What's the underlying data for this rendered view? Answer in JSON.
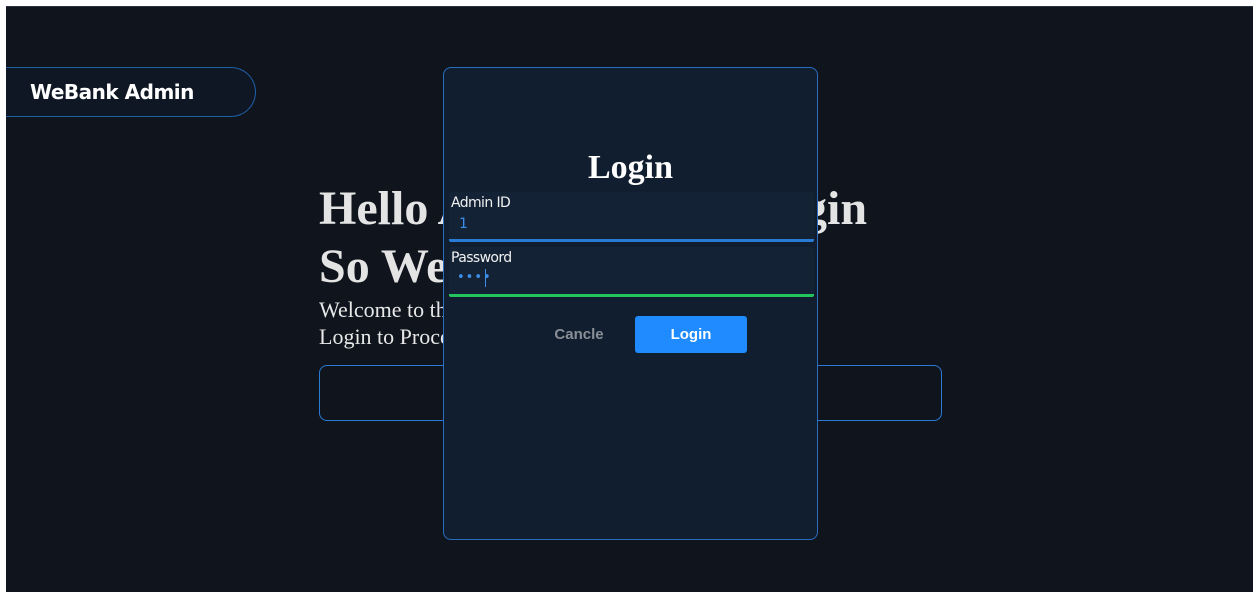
{
  "brand": {
    "title": "WeBank Admin"
  },
  "hero": {
    "heading_line1": "Hello Admin! Please Login",
    "heading_line2": "So We Can Verify You!",
    "line1": "Welcome to the WeBank Admin Portal.",
    "line2": "Login to Proceed.",
    "action_label": ""
  },
  "modal": {
    "title": "Login",
    "admin_id": {
      "label": "Admin ID",
      "value": "1"
    },
    "password": {
      "label": "Password",
      "value": "••••"
    },
    "cancel_label": "Cancle",
    "login_label": "Login"
  },
  "colors": {
    "background": "#0f141d",
    "modal": "#111e2f",
    "accent": "#1f8bff",
    "border": "#2a7bd6",
    "valid": "#22c55e"
  }
}
